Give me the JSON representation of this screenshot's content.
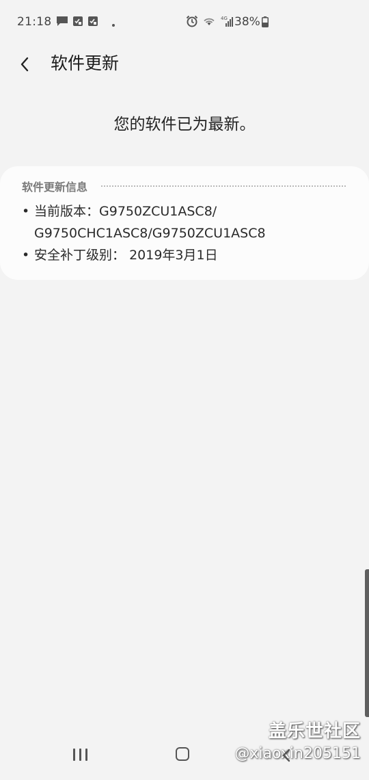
{
  "status_bar": {
    "time": "21:18",
    "battery": "38%",
    "network": "4G"
  },
  "header": {
    "title": "软件更新"
  },
  "main": {
    "status_message": "您的软件已为最新。"
  },
  "info_card": {
    "title": "软件更新信息",
    "items": [
      {
        "label": "当前版本：",
        "value_line1": "G9750ZCU1ASC8/",
        "value_line2": "G9750CHC1ASC8/G9750ZCU1ASC8"
      },
      {
        "label": "安全补丁级别：",
        "value": "2019年3月1日"
      }
    ]
  },
  "watermark": {
    "title": "盖乐世社区",
    "handle": "@xiaoxin205151"
  },
  "icons": {
    "back": "chevron-left-icon",
    "recents": "recents-icon",
    "home": "home-icon",
    "nav_back": "nav-back-icon"
  },
  "colors": {
    "background": "#f3f3f3",
    "card": "#fcfcfc",
    "text": "#1e1e1e",
    "muted": "#7a7a7a"
  }
}
